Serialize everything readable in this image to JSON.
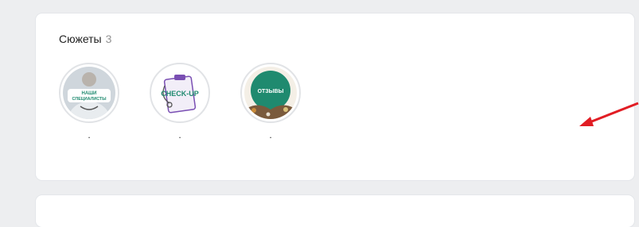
{
  "stories_section": {
    "title": "Сюжеты",
    "count": "3",
    "items": [
      {
        "thumb_text_1": "НАШИ",
        "thumb_text_2": "СПЕЦИАЛИСТЫ",
        "label": "."
      },
      {
        "thumb_text": "CHECK-UP",
        "label": "."
      },
      {
        "thumb_text": "ОТЗЫВЫ",
        "label": "."
      }
    ]
  },
  "colors": {
    "page_bg": "#edeef0",
    "card_bg": "#ffffff",
    "brand_green": "#1f8a6f",
    "arrow_red": "#e11d24"
  }
}
